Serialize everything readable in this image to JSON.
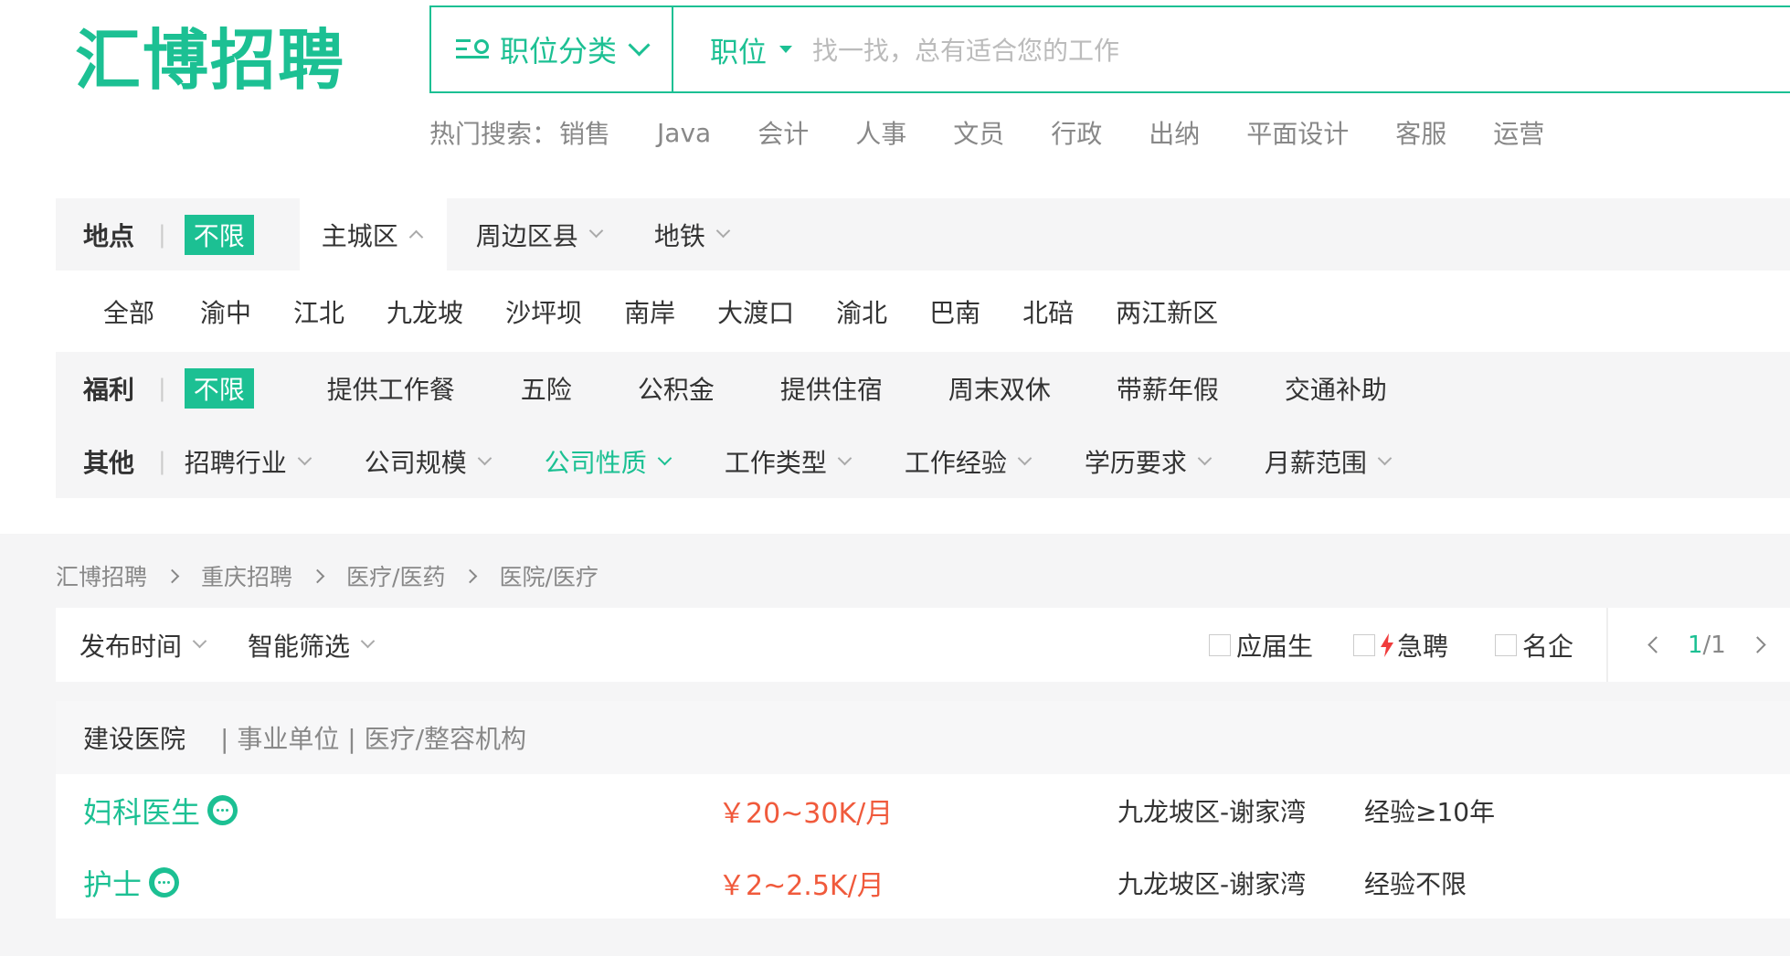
{
  "brand": {
    "logo_text": "汇博招聘",
    "accent_color": "#1cc093",
    "salary_color": "#f05a3c"
  },
  "search": {
    "category_label": "职位分类",
    "type_label": "职位",
    "placeholder": "找一找，总有适合您的工作"
  },
  "hot_search": {
    "label": "热门搜索：",
    "terms": [
      "销售",
      "Java",
      "会计",
      "人事",
      "文员",
      "行政",
      "出纳",
      "平面设计",
      "客服",
      "运营"
    ]
  },
  "filters": {
    "location": {
      "label": "地点",
      "all_label": "不限",
      "tabs": [
        "主城区",
        "周边区县",
        "地铁"
      ],
      "districts": [
        "全部",
        "渝中",
        "江北",
        "九龙坡",
        "沙坪坝",
        "南岸",
        "大渡口",
        "渝北",
        "巴南",
        "北碚",
        "两江新区"
      ]
    },
    "welfare": {
      "label": "福利",
      "all_label": "不限",
      "items": [
        "提供工作餐",
        "五险",
        "公积金",
        "提供住宿",
        "周末双休",
        "带薪年假",
        "交通补助"
      ]
    },
    "other": {
      "label": "其他",
      "items": [
        "招聘行业",
        "公司规模",
        "公司性质",
        "工作类型",
        "工作经验",
        "学历要求",
        "月薪范围"
      ]
    }
  },
  "breadcrumb": [
    "汇博招聘",
    "重庆招聘",
    "医疗/医药",
    "医院/医疗"
  ],
  "sort_bar": {
    "dropdowns": [
      "发布时间",
      "智能筛选"
    ],
    "checks": [
      "应届生",
      "急聘",
      "名企"
    ],
    "page": {
      "current": "1",
      "total": "/1"
    }
  },
  "company": {
    "name": "建设医院",
    "meta": "| 事业单位 | 医疗/整容机构"
  },
  "jobs": [
    {
      "title": "妇科医生",
      "salary": "￥20~30K/月",
      "location": "九龙坡区-谢家湾",
      "experience": "经验≥10年"
    },
    {
      "title": "护士",
      "salary": "￥2~2.5K/月",
      "location": "九龙坡区-谢家湾",
      "experience": "经验不限"
    }
  ]
}
